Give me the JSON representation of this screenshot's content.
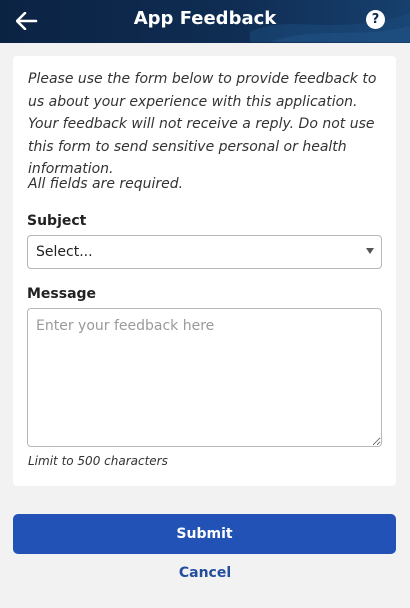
{
  "header": {
    "title": "App Feedback",
    "back_icon": "arrow-left-icon",
    "help_icon": "question-circle-icon",
    "help_glyph": "?"
  },
  "form": {
    "intro": "Please use the form below to provide feedback to us about your experience with this application. Your feedback will not receive a reply. Do not use this form to send sensitive personal or health information.",
    "required_note": "All fields are required.",
    "subject_label": "Subject",
    "subject_value": "Select...",
    "message_label": "Message",
    "message_placeholder": "Enter your feedback here",
    "limit_note": "Limit to 500 characters"
  },
  "actions": {
    "submit_label": "Submit",
    "cancel_label": "Cancel"
  },
  "colors": {
    "header_bg": "#0f2c52",
    "submit_bg": "#2352b6",
    "link": "#244d9c",
    "page_bg": "#f2f2f2"
  }
}
